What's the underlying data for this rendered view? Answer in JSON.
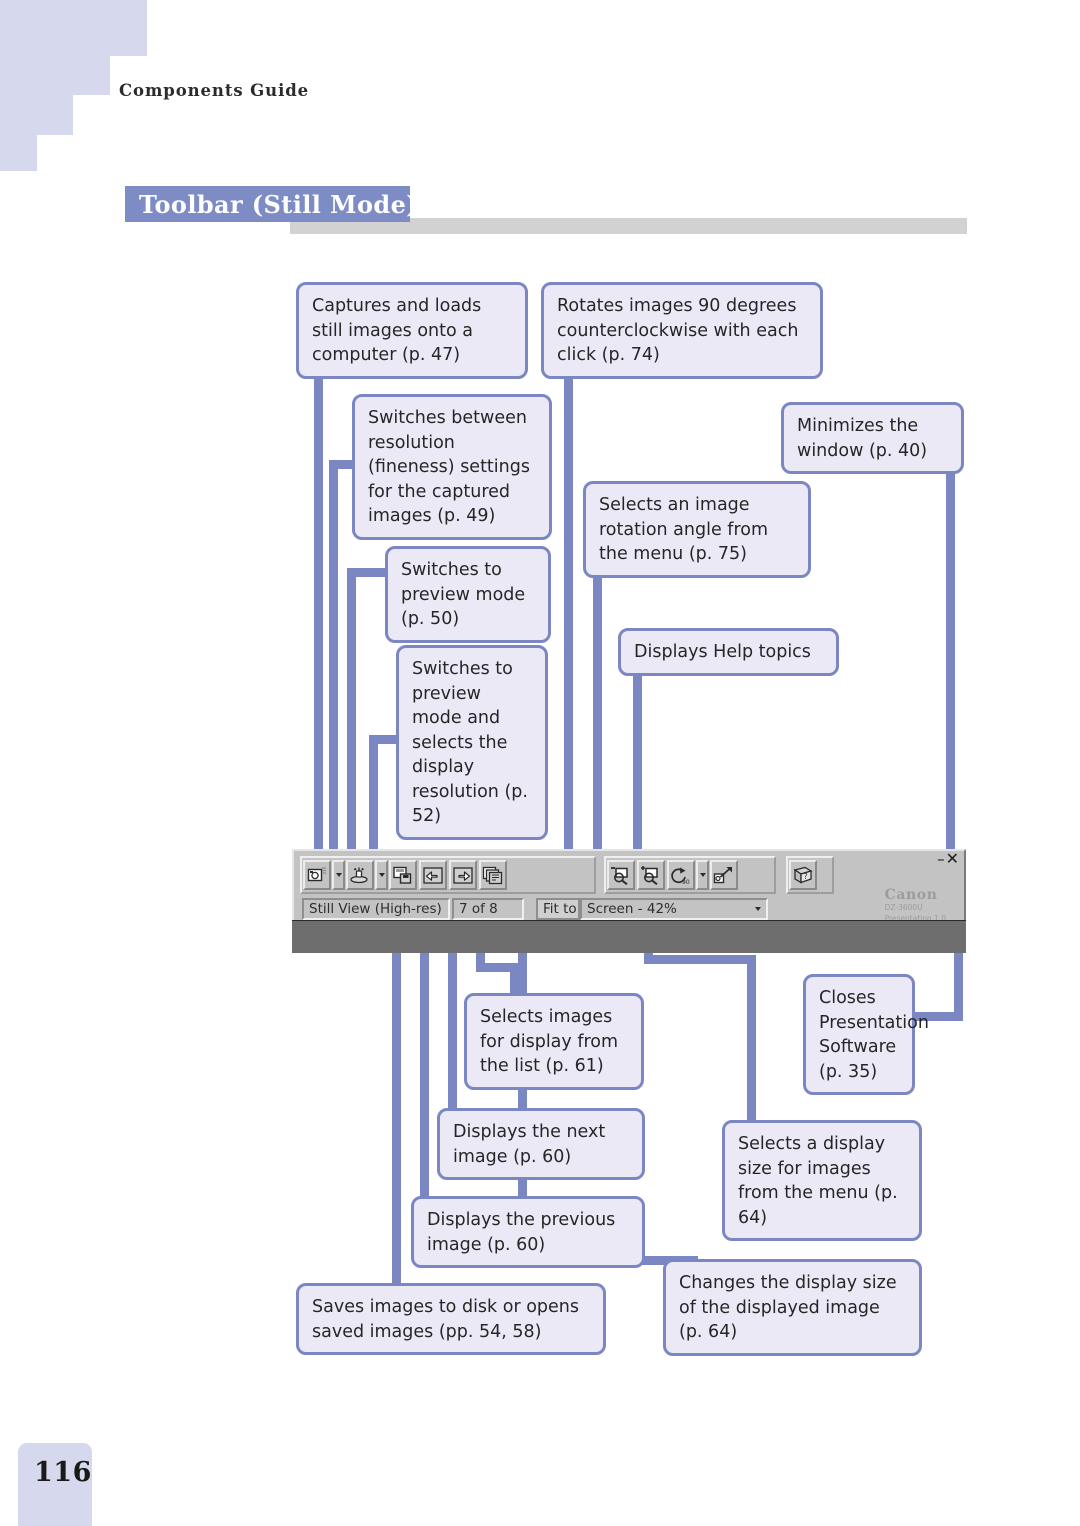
{
  "page": {
    "running_head": "Components Guide",
    "section_title": "Toolbar (Still Mode)",
    "page_number": "116"
  },
  "callouts": [
    {
      "id": "capture",
      "text": "Captures and loads still images onto a computer (p. 47)"
    },
    {
      "id": "rotate90",
      "text": "Rotates images 90 degrees counterclockwise with each click (p. 74)"
    },
    {
      "id": "resolution",
      "text": "Switches between resolution (fineness) settings for the captured images (p. 49)"
    },
    {
      "id": "minimize",
      "text": "Minimizes the window (p. 40)"
    },
    {
      "id": "rotate-menu",
      "text": "Selects an image rotation angle from the menu (p. 75)"
    },
    {
      "id": "preview",
      "text": "Switches to preview mode (p. 50)"
    },
    {
      "id": "help",
      "text": "Displays Help topics"
    },
    {
      "id": "preview-res",
      "text": "Switches to preview mode and selects the display resolution (p. 52)"
    },
    {
      "id": "select-list",
      "text": "Selects images for display from the list (p. 61)"
    },
    {
      "id": "close",
      "text": "Closes Presentation Software (p. 35)"
    },
    {
      "id": "next-image",
      "text": "Displays the next image (p. 60)"
    },
    {
      "id": "display-size",
      "text": "Selects a display size for images from the menu (p. 64)"
    },
    {
      "id": "prev-image",
      "text": "Displays the previous image (p. 60)"
    },
    {
      "id": "save-open",
      "text": "Saves images to disk or opens saved images (pp. 54, 58)"
    },
    {
      "id": "change-size",
      "text": "Changes the display size of the displayed image (p. 64)"
    }
  ],
  "toolbar": {
    "status_mode": "Still View (High-res)",
    "status_count": "7 of 8",
    "status_fit": "Fit to",
    "status_zoom": "Screen - 42%",
    "brand": "Canon",
    "model": "DZ-3600U",
    "software": "Presentation 1.0",
    "minimize_glyph": "–",
    "close_glyph": "✕",
    "buttons": [
      {
        "id": "capture-button",
        "icon": "camera-capture-icon"
      },
      {
        "id": "capture-dropdown",
        "icon": "chevron-down-icon"
      },
      {
        "id": "resolution-button",
        "icon": "scanner-resolution-icon"
      },
      {
        "id": "resolution-dropdown",
        "icon": "chevron-down-icon"
      },
      {
        "id": "save-open-button",
        "icon": "save-disk-icon"
      },
      {
        "id": "previous-image-button",
        "icon": "arrow-left-icon"
      },
      {
        "id": "next-image-button",
        "icon": "arrow-right-icon"
      },
      {
        "id": "image-list-button",
        "icon": "image-list-icon"
      },
      {
        "id": "zoom-out-button",
        "icon": "magnifier-minus-icon"
      },
      {
        "id": "zoom-in-button",
        "icon": "magnifier-plus-icon"
      },
      {
        "id": "rotate-button",
        "icon": "rotate-90-icon"
      },
      {
        "id": "rotate-dropdown",
        "icon": "chevron-down-icon"
      },
      {
        "id": "display-size-button",
        "icon": "resize-arrow-icon"
      },
      {
        "id": "help-button",
        "icon": "help-book-icon"
      }
    ]
  },
  "colors": {
    "accent": "#7b87c2",
    "title_bar": "#7d8cc4",
    "callout_fill": "#ebe9f6",
    "decor": "#d6d8ed",
    "grey_bar": "#d2d2d2"
  }
}
